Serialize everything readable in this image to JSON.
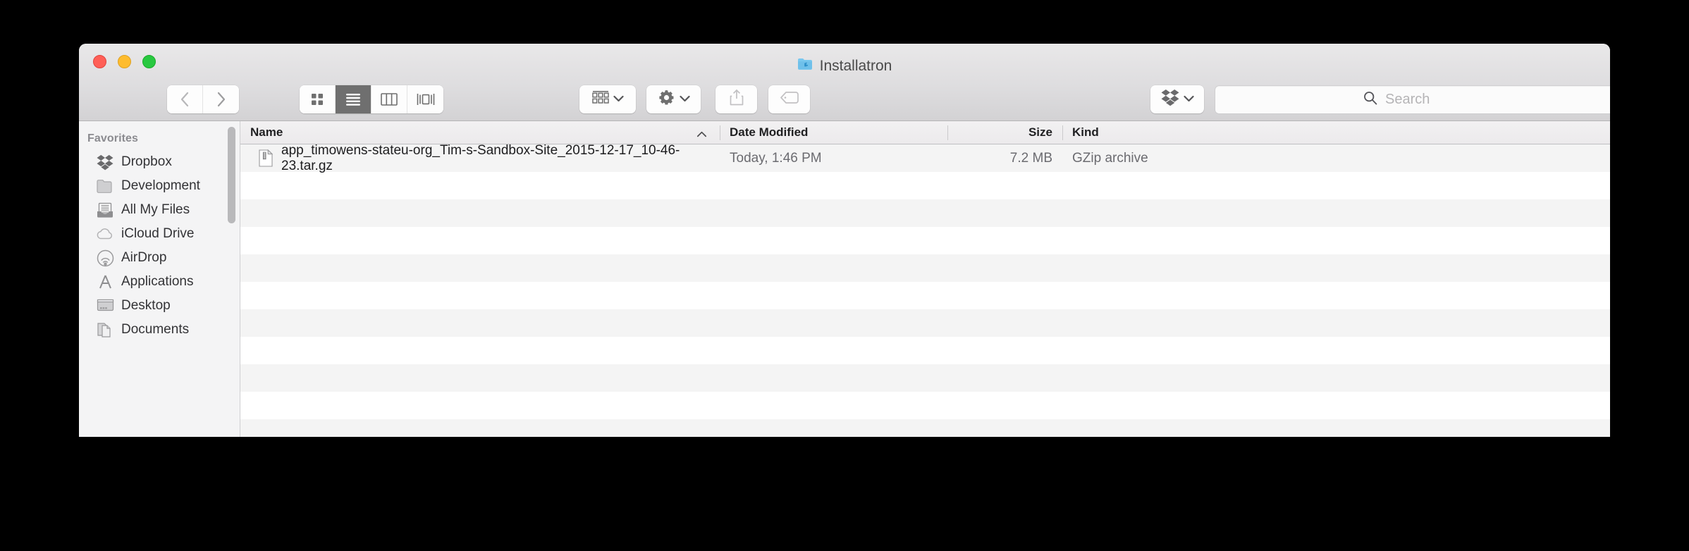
{
  "window": {
    "title": "Installatron",
    "title_icon": "folder-puzzle-icon",
    "traffic_lights": [
      {
        "name": "close-button",
        "color": "#ff5f57"
      },
      {
        "name": "minimize-button",
        "color": "#febc2e"
      },
      {
        "name": "zoom-button",
        "color": "#28c840"
      }
    ]
  },
  "toolbar": {
    "back_icon": "chevron-left-icon",
    "forward_icon": "chevron-right-icon",
    "view_modes": [
      {
        "id": "icon-view",
        "icon": "grid-icon",
        "selected": false
      },
      {
        "id": "list-view",
        "icon": "list-icon",
        "selected": true
      },
      {
        "id": "column-view",
        "icon": "columns-icon",
        "selected": false
      },
      {
        "id": "coverflow-view",
        "icon": "coverflow-icon",
        "selected": false
      }
    ],
    "arrange": {
      "icon": "arrange-grid-icon",
      "chevron": "chevron-down-icon"
    },
    "action": {
      "icon": "gear-icon",
      "chevron": "chevron-down-icon"
    },
    "share": {
      "icon": "share-icon",
      "enabled": false
    },
    "tag": {
      "icon": "tag-icon",
      "enabled": false
    },
    "dropbox": {
      "icon": "dropbox-icon",
      "chevron": "chevron-down-icon"
    }
  },
  "search": {
    "icon": "search-icon",
    "value": "",
    "placeholder": "Search"
  },
  "sidebar": {
    "section_label": "Favorites",
    "items": [
      {
        "label": "Dropbox",
        "icon": "dropbox-icon"
      },
      {
        "label": "Development",
        "icon": "folder-icon"
      },
      {
        "label": "All My Files",
        "icon": "all-my-files-icon"
      },
      {
        "label": "iCloud Drive",
        "icon": "cloud-icon"
      },
      {
        "label": "AirDrop",
        "icon": "airdrop-icon"
      },
      {
        "label": "Applications",
        "icon": "applications-icon"
      },
      {
        "label": "Desktop",
        "icon": "desktop-icon"
      },
      {
        "label": "Documents",
        "icon": "documents-icon"
      }
    ]
  },
  "file_list": {
    "columns": [
      {
        "key": "name",
        "label": "Name",
        "sorted": true,
        "sort_direction": "ascending",
        "sort_icon": "chevron-up-icon"
      },
      {
        "key": "date",
        "label": "Date Modified"
      },
      {
        "key": "size",
        "label": "Size"
      },
      {
        "key": "kind",
        "label": "Kind"
      }
    ],
    "rows": [
      {
        "icon": "generic-document-icon",
        "name": "app_timowens-stateu-org_Tim-s-Sandbox-Site_2015-12-17_10-46-23.tar.gz",
        "date": "Today, 1:46 PM",
        "size": "7.2 MB",
        "kind": "GZip archive"
      }
    ],
    "empty_row_count": 11
  }
}
